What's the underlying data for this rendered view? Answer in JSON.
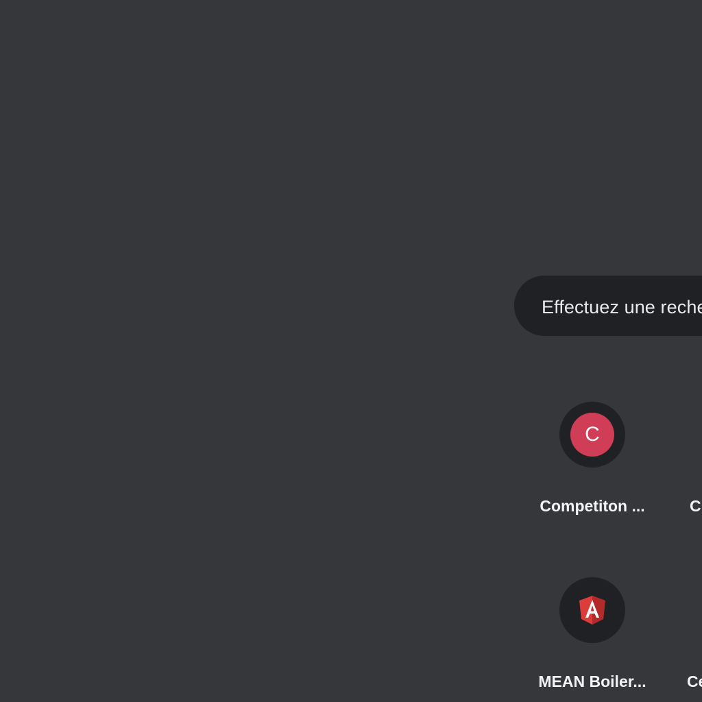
{
  "search": {
    "placeholder": "Effectuez une recherche sur Google ou saisissez une URL"
  },
  "shortcuts": [
    {
      "title": "Competiton ...",
      "icon": "letter-c-icon",
      "icon_letter": "C",
      "icon_color": "#cf3d56"
    },
    {
      "title": "C",
      "icon": "unknown"
    },
    {
      "title": "MEAN Boiler...",
      "icon": "angular-icon",
      "icon_color": "#dd3d3a"
    },
    {
      "title": "Ce",
      "icon": "unknown"
    }
  ],
  "colors": {
    "background": "#35373a",
    "searchbox": "#202124",
    "shortcut_circle": "#202124",
    "text": "#f1f3f4"
  }
}
